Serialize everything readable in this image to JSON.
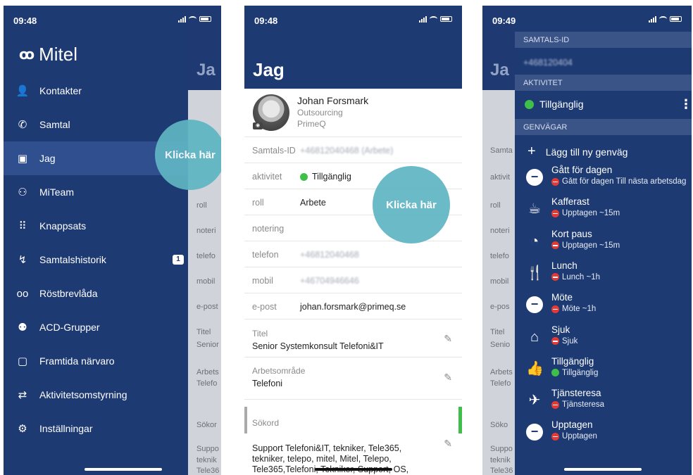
{
  "phone1": {
    "time": "09:48",
    "logo": "Mitel",
    "bg_title": "Ja",
    "bg_cells": [
      "roll",
      "noteri",
      "telefo",
      "mobil",
      "e-post",
      "Titel",
      "Senior",
      "Arbets",
      "Telefo",
      "Sökor",
      "Suppo",
      "teknik",
      "Tele36"
    ],
    "menu": [
      {
        "icon": "person-icon",
        "glyph": "👤",
        "label": "Kontakter"
      },
      {
        "icon": "phone-icon",
        "glyph": "✆",
        "label": "Samtal"
      },
      {
        "icon": "id-card-icon",
        "glyph": "▣",
        "label": "Jag",
        "active": true
      },
      {
        "icon": "team-icon",
        "glyph": "⚇",
        "label": "MiTeam"
      },
      {
        "icon": "keypad-icon",
        "glyph": "⠿",
        "label": "Knappsats"
      },
      {
        "icon": "call-history-icon",
        "glyph": "↯",
        "label": "Samtalshistorik",
        "badge": "1"
      },
      {
        "icon": "voicemail-icon",
        "glyph": "ᴏᴏ",
        "label": "Röstbrevlåda"
      },
      {
        "icon": "acd-group-icon",
        "glyph": "⚉",
        "label": "ACD-Grupper"
      },
      {
        "icon": "calendar-icon",
        "glyph": "▢",
        "label": "Framtida närvaro"
      },
      {
        "icon": "activity-routing-icon",
        "glyph": "⇄",
        "label": "Aktivitetsomstyrning"
      },
      {
        "icon": "gear-icon",
        "glyph": "⚙",
        "label": "Inställningar"
      }
    ],
    "bubble": "Klicka här"
  },
  "phone2": {
    "time": "09:48",
    "title": "Jag",
    "profile": {
      "name": "Johan Forsmark",
      "company": "Outsourcing",
      "org": "PrimeQ"
    },
    "rows": [
      {
        "label": "Samtals-ID",
        "value": "+46812040468 (Arbete)",
        "blurred": true
      },
      {
        "label": "aktivitet",
        "value": "Tillgänglig",
        "status": "green"
      },
      {
        "label": "roll",
        "value": "Arbete"
      },
      {
        "label": "notering",
        "value": ""
      },
      {
        "label": "telefon",
        "value": "+46812040468",
        "blurred": true
      },
      {
        "label": "mobil",
        "value": "+46704946646",
        "blurred": true
      },
      {
        "label": "e-post",
        "value": "johan.forsmark@primeq.se"
      }
    ],
    "titel": {
      "label": "Titel",
      "value": "Senior Systemkonsult Telefoni&IT"
    },
    "arbetsomrade": {
      "label": "Arbetsområde",
      "value": "Telefoni"
    },
    "sokord": {
      "label": "Sökord",
      "value": "Support Telefoni&IT, tekniker, Tele365, tekniker, telepo, mitel, Mitel, Telepo, Tele365,Telefoni, Tekniker, Support, OS,"
    },
    "bubble": "Klicka här"
  },
  "phone3": {
    "time": "09:49",
    "bg_title": "Ja",
    "bg_cells": [
      "Samta",
      "aktivit",
      "roll",
      "noteri",
      "telefo",
      "mobil",
      "e-pos",
      "Titel",
      "Senio",
      "Arbets",
      "Telefo",
      "Söko",
      "Suppo",
      "teknik",
      "Tele36"
    ],
    "sections": {
      "call_id": "SAMTALS-ID",
      "activity": "AKTIVITET",
      "shortcuts": "GENVÄGAR"
    },
    "call_id_value": "+468120404",
    "activity_value": "Tillgänglig",
    "add_shortcut": "Lägg till ny genväg",
    "shortcuts": [
      {
        "icon": "minus-circle-icon",
        "glyph": "−",
        "circle": true,
        "name": "Gått för dagen",
        "status": "red",
        "sub": "Gått för dagen Till nästa arbetsdag"
      },
      {
        "icon": "coffee-icon",
        "glyph": "☕",
        "name": "Kafferast",
        "status": "red",
        "sub": "Upptagen ~15m"
      },
      {
        "icon": "clock-icon",
        "glyph": "◔",
        "name": "Kort paus",
        "status": "red",
        "sub": "Upptagen ~15m"
      },
      {
        "icon": "cutlery-icon",
        "glyph": "🍴",
        "name": "Lunch",
        "status": "red",
        "sub": "Lunch ~1h"
      },
      {
        "icon": "minus-circle-icon",
        "glyph": "−",
        "circle": true,
        "name": "Möte",
        "status": "red",
        "sub": "Möte ~1h"
      },
      {
        "icon": "home-icon",
        "glyph": "⌂",
        "name": "Sjuk",
        "status": "red",
        "sub": "Sjuk"
      },
      {
        "icon": "thumbs-up-icon",
        "glyph": "👍",
        "name": "Tillgänglig",
        "status": "green",
        "sub": "Tillgänglig"
      },
      {
        "icon": "airplane-icon",
        "glyph": "✈",
        "name": "Tjänsteresa",
        "status": "red",
        "sub": "Tjänsteresa"
      },
      {
        "icon": "minus-circle-icon",
        "glyph": "−",
        "circle": true,
        "name": "Upptagen",
        "status": "red",
        "sub": "Upptagen"
      }
    ]
  },
  "colors": {
    "navy": "#1d3a73",
    "teal_bubble": "#5fb5c3",
    "green": "#3fbf4a",
    "red": "#e53935"
  }
}
